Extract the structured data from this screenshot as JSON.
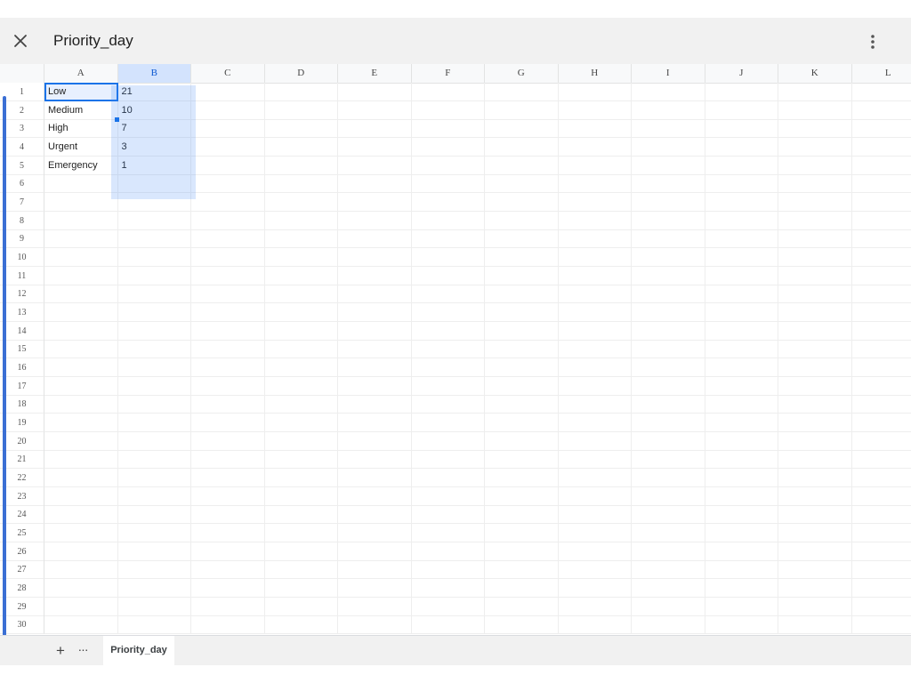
{
  "window": {
    "title": "Priority_day"
  },
  "icons": {
    "close": "close-icon",
    "more": "more-vert-icon",
    "add": "plus-icon",
    "all_sheets": "ellipsis-icon"
  },
  "colors": {
    "selection": "#d3e3fd",
    "active_border": "#1a73e8",
    "accent_bar": "#3b6fd4"
  },
  "grid": {
    "columns": [
      "A",
      "B",
      "C",
      "D",
      "E",
      "F",
      "G",
      "H",
      "I",
      "J",
      "K",
      "L"
    ],
    "selected_column": "B",
    "rows": [
      {
        "num": "1",
        "a": "Low",
        "b": "21"
      },
      {
        "num": "2",
        "a": "Medium",
        "b": "10"
      },
      {
        "num": "3",
        "a": "High",
        "b": "7"
      },
      {
        "num": "4",
        "a": "Urgent",
        "b": "3"
      },
      {
        "num": "5",
        "a": "Emergency",
        "b": "1"
      },
      {
        "num": "6",
        "a": "",
        "b": ""
      },
      {
        "num": "7",
        "a": "",
        "b": ""
      },
      {
        "num": "8",
        "a": "",
        "b": ""
      },
      {
        "num": "9",
        "a": "",
        "b": ""
      },
      {
        "num": "10",
        "a": "",
        "b": ""
      },
      {
        "num": "11",
        "a": "",
        "b": ""
      },
      {
        "num": "12",
        "a": "",
        "b": ""
      },
      {
        "num": "13",
        "a": "",
        "b": ""
      },
      {
        "num": "14",
        "a": "",
        "b": ""
      },
      {
        "num": "15",
        "a": "",
        "b": ""
      },
      {
        "num": "16",
        "a": "",
        "b": ""
      },
      {
        "num": "17",
        "a": "",
        "b": ""
      },
      {
        "num": "18",
        "a": "",
        "b": ""
      },
      {
        "num": "19",
        "a": "",
        "b": ""
      },
      {
        "num": "20",
        "a": "",
        "b": ""
      },
      {
        "num": "21",
        "a": "",
        "b": ""
      },
      {
        "num": "22",
        "a": "",
        "b": ""
      },
      {
        "num": "23",
        "a": "",
        "b": ""
      },
      {
        "num": "24",
        "a": "",
        "b": ""
      },
      {
        "num": "25",
        "a": "",
        "b": ""
      },
      {
        "num": "26",
        "a": "",
        "b": ""
      },
      {
        "num": "27",
        "a": "",
        "b": ""
      },
      {
        "num": "28",
        "a": "",
        "b": ""
      },
      {
        "num": "29",
        "a": "",
        "b": ""
      },
      {
        "num": "30",
        "a": "",
        "b": ""
      }
    ]
  },
  "sheets": {
    "tabs": [
      "Priority_day"
    ]
  },
  "tabbar": {
    "add_label": "+",
    "all_label": "···"
  }
}
